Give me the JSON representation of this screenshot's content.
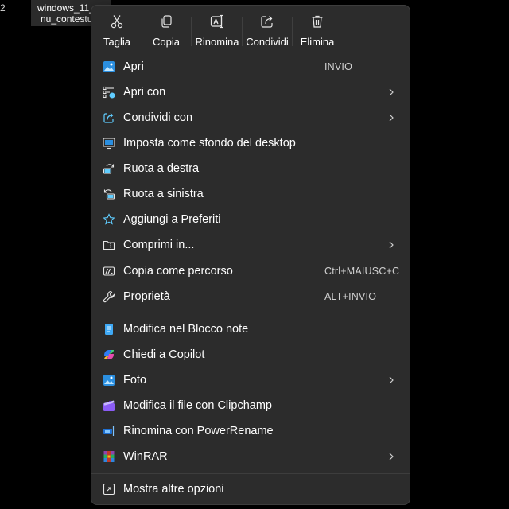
{
  "background": {
    "number": "2",
    "file_name_line1": "windows_11_",
    "file_name_line2": "nu_contestu"
  },
  "toolbar": {
    "cut": "Taglia",
    "copy": "Copia",
    "rename": "Rinomina",
    "share": "Condividi",
    "delete": "Elimina"
  },
  "menu": {
    "open": "Apri",
    "open_shortcut": "INVIO",
    "open_with": "Apri con",
    "share_with": "Condividi con",
    "set_wallpaper": "Imposta come sfondo del desktop",
    "rotate_right": "Ruota a destra",
    "rotate_left": "Ruota a sinistra",
    "add_favorites": "Aggiungi a Preferiti",
    "compress": "Comprimi in...",
    "copy_path": "Copia come percorso",
    "copy_path_shortcut": "Ctrl+MAIUSC+C",
    "properties": "Proprietà",
    "properties_shortcut": "ALT+INVIO",
    "notepad": "Modifica nel Blocco note",
    "copilot": "Chiedi a Copilot",
    "photos": "Foto",
    "clipchamp": "Modifica il file con Clipchamp",
    "powerrename": "Rinomina con PowerRename",
    "winrar": "WinRAR",
    "more_options": "Mostra altre opzioni"
  },
  "colors": {
    "menu_bg": "#2c2c2c",
    "accent": "#60cdff",
    "text": "#ffffff"
  }
}
